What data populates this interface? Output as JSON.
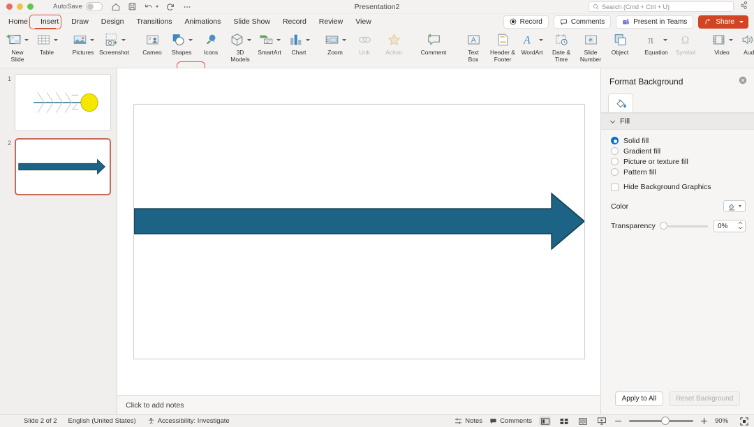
{
  "titlebar": {
    "autosave_label": "AutoSave",
    "autosave_state": "off",
    "document_title": "Presentation2",
    "quick_access": [
      "home-icon",
      "save-icon",
      "undo-icon",
      "redo-icon",
      "more-icon"
    ],
    "search_placeholder": "Search (Cmd + Ctrl + U)",
    "collab_icon": "share-link-icon"
  },
  "tabs": {
    "items": [
      {
        "label": "Home"
      },
      {
        "label": "Insert"
      },
      {
        "label": "Draw"
      },
      {
        "label": "Design"
      },
      {
        "label": "Transitions"
      },
      {
        "label": "Animations"
      },
      {
        "label": "Slide Show"
      },
      {
        "label": "Record"
      },
      {
        "label": "Review"
      },
      {
        "label": "View"
      }
    ],
    "active": "Insert",
    "highlight_color": "#d4543a"
  },
  "header_buttons": {
    "record": "Record",
    "comments": "Comments",
    "present_in_teams": "Present in Teams",
    "share": "Share",
    "share_color": "#d14524"
  },
  "ribbon": {
    "highlighted_item": "Shapes",
    "highlight_color": "#e2543b",
    "groups": [
      {
        "items": [
          {
            "label": "New\nSlide",
            "label_line1": "New",
            "label_line2": "Slide",
            "icon": "new-slide-icon",
            "caret": true,
            "enabled": true
          },
          {
            "label": "Table",
            "icon": "table-icon",
            "caret": true,
            "enabled": true
          }
        ]
      },
      {
        "items": [
          {
            "label": "Pictures",
            "icon": "pictures-icon",
            "caret": true,
            "enabled": true
          },
          {
            "label": "Screenshot",
            "icon": "screenshot-icon",
            "caret": true,
            "enabled": true
          }
        ]
      },
      {
        "items": [
          {
            "label": "Cameo",
            "icon": "cameo-icon",
            "caret": false,
            "enabled": true
          },
          {
            "label": "Shapes",
            "icon": "shapes-icon",
            "caret": true,
            "enabled": true
          },
          {
            "label": "Icons",
            "icon": "icons-icon",
            "caret": false,
            "enabled": true
          },
          {
            "label_line1": "3D",
            "label_line2": "Models",
            "label": "3D Models",
            "icon": "3d-models-icon",
            "caret": true,
            "enabled": true
          },
          {
            "label": "SmartArt",
            "icon": "smartart-icon",
            "caret": true,
            "enabled": true
          },
          {
            "label": "Chart",
            "icon": "chart-icon",
            "caret": true,
            "enabled": true
          }
        ]
      },
      {
        "items": [
          {
            "label": "Zoom",
            "icon": "zoom-icon",
            "caret": true,
            "enabled": true
          },
          {
            "label": "Link",
            "icon": "link-icon",
            "caret": false,
            "enabled": false
          },
          {
            "label": "Action",
            "icon": "action-icon",
            "caret": false,
            "enabled": false
          }
        ]
      },
      {
        "items": [
          {
            "label": "Comment",
            "icon": "comment-icon",
            "caret": false,
            "enabled": true
          }
        ]
      },
      {
        "items": [
          {
            "label_line1": "Text",
            "label_line2": "Box",
            "label": "Text Box",
            "icon": "text-box-icon",
            "caret": false,
            "enabled": true
          },
          {
            "label_line1": "Header &",
            "label_line2": "Footer",
            "label": "Header & Footer",
            "icon": "header-footer-icon",
            "caret": false,
            "enabled": true
          },
          {
            "label": "WordArt",
            "icon": "wordart-icon",
            "caret": true,
            "enabled": true
          },
          {
            "label_line1": "Date &",
            "label_line2": "Time",
            "label": "Date & Time",
            "icon": "date-time-icon",
            "caret": false,
            "enabled": true
          },
          {
            "label_line1": "Slide",
            "label_line2": "Number",
            "label": "Slide Number",
            "icon": "slide-number-icon",
            "caret": false,
            "enabled": true
          },
          {
            "label": "Object",
            "icon": "object-icon",
            "caret": false,
            "enabled": true
          }
        ]
      },
      {
        "items": [
          {
            "label": "Equation",
            "icon": "equation-icon",
            "caret": true,
            "enabled": true
          },
          {
            "label": "Symbol",
            "icon": "symbol-icon",
            "caret": false,
            "enabled": false
          }
        ]
      },
      {
        "items": [
          {
            "label": "Video",
            "icon": "video-icon",
            "caret": true,
            "enabled": true
          },
          {
            "label": "Audio",
            "icon": "audio-icon",
            "caret": true,
            "enabled": true
          }
        ]
      }
    ]
  },
  "thumbnails": {
    "slides": [
      {
        "number": "1",
        "selected": false,
        "content": "fishbone-diagram-with-yellow-circle"
      },
      {
        "number": "2",
        "selected": true,
        "content": "blue-block-arrow"
      }
    ],
    "selection_color": "#c56a58"
  },
  "slide": {
    "arrow_fill": "#1d6385",
    "arrow_outline": "#123d52",
    "background": "#ffffff"
  },
  "notes": {
    "placeholder": "Click to add notes"
  },
  "format_background": {
    "title": "Format Background",
    "close_icon": "close-icon",
    "tab_icon": "fill-bucket-icon",
    "section_title": "Fill",
    "fill_options": [
      {
        "label": "Solid fill",
        "selected": true
      },
      {
        "label": "Gradient fill",
        "selected": false
      },
      {
        "label": "Picture or texture fill",
        "selected": false
      },
      {
        "label": "Pattern fill",
        "selected": false
      }
    ],
    "hide_background_graphics": {
      "label": "Hide Background Graphics",
      "checked": false
    },
    "color_label": "Color",
    "transparency_label": "Transparency",
    "transparency_value": "0%",
    "apply_to_all": "Apply to All",
    "reset_background": "Reset Background",
    "reset_disabled": true
  },
  "status_bar": {
    "slide_count": "Slide 2 of 2",
    "language": "English (United States)",
    "accessibility": "Accessibility: Investigate",
    "notes_label": "Notes",
    "comments_label": "Comments",
    "zoom_level": "90%",
    "views": [
      "normal-view-icon",
      "slide-sorter-icon",
      "reading-view-icon",
      "slide-show-icon"
    ],
    "active_view": "normal-view-icon",
    "fit_icon": "fit-slide-icon"
  }
}
